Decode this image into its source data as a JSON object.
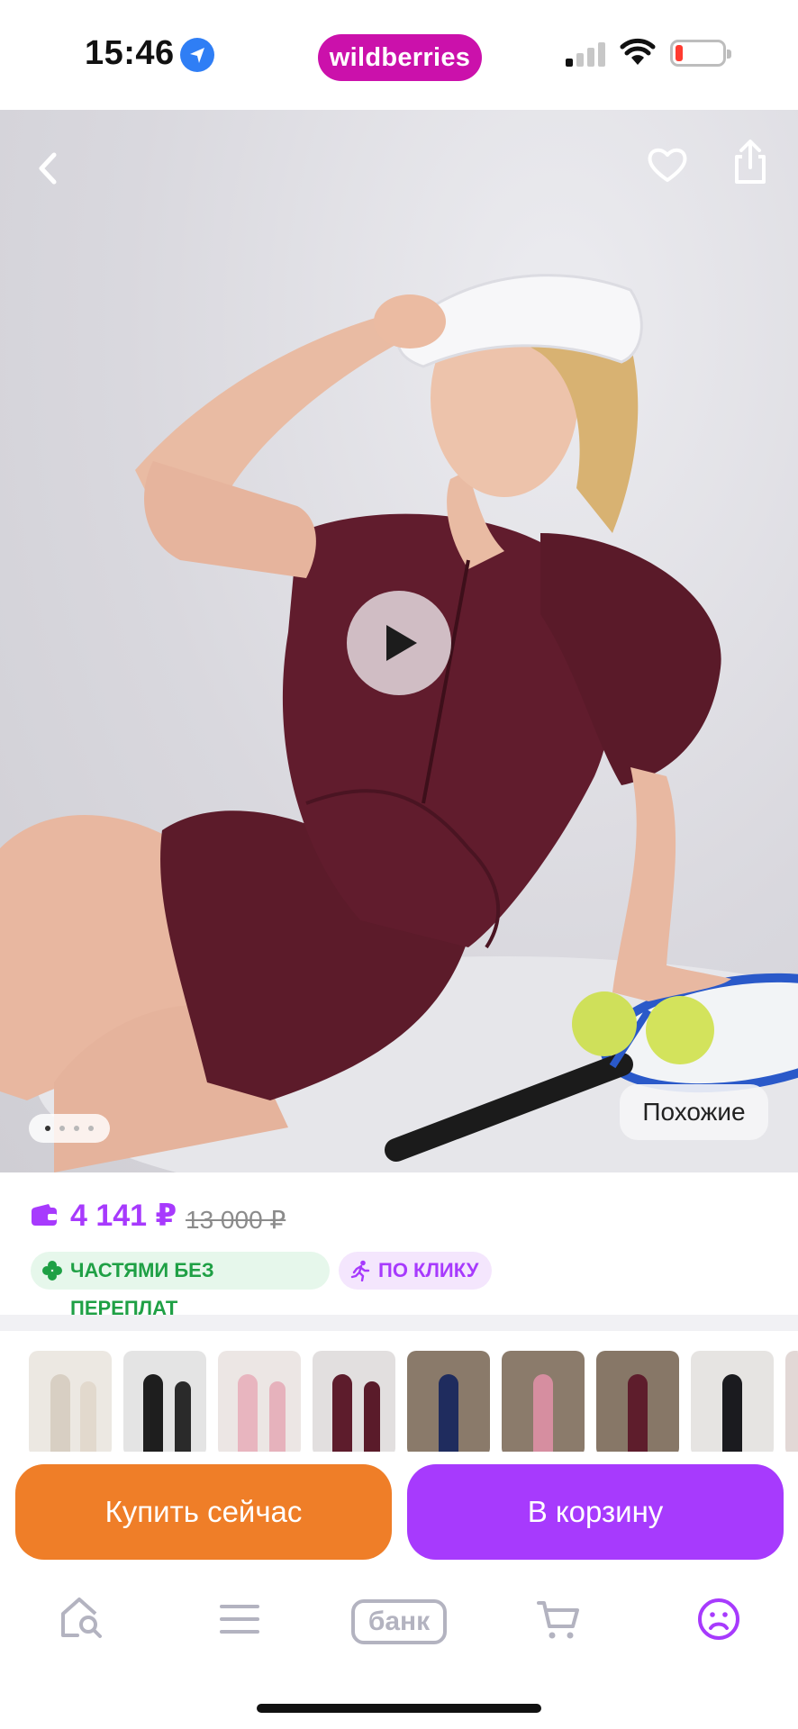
{
  "status_bar": {
    "time": "15:46",
    "brand": "wildberries",
    "icons": [
      "location-arrow-icon",
      "cellular-signal-icon",
      "wifi-icon",
      "battery-low-icon"
    ]
  },
  "hero": {
    "icons": [
      "back-chevron-icon",
      "heart-icon",
      "share-icon",
      "play-icon"
    ],
    "similar_label": "Похожие",
    "image_count": 4,
    "active_image": 1
  },
  "price": {
    "current": "4 141 ₽",
    "old": "13 000 ₽",
    "installment_badge": "ЧАСТЯМИ БЕЗ ПЕРЕПЛАТ",
    "one_click_badge": "ПО КЛИКУ"
  },
  "actions": {
    "buy_now": "Купить сейчас",
    "add_to_cart": "В корзину"
  },
  "tabbar": {
    "bank_label": "банк",
    "items": [
      "home-search-icon",
      "catalog-menu-icon",
      "bank-tab",
      "cart-icon",
      "profile-icon"
    ]
  },
  "colors": {
    "brand": "#cb11ab",
    "accent_purple": "#a73afd",
    "buy_orange": "#ef7e28",
    "installment_green": "#1fa045"
  }
}
